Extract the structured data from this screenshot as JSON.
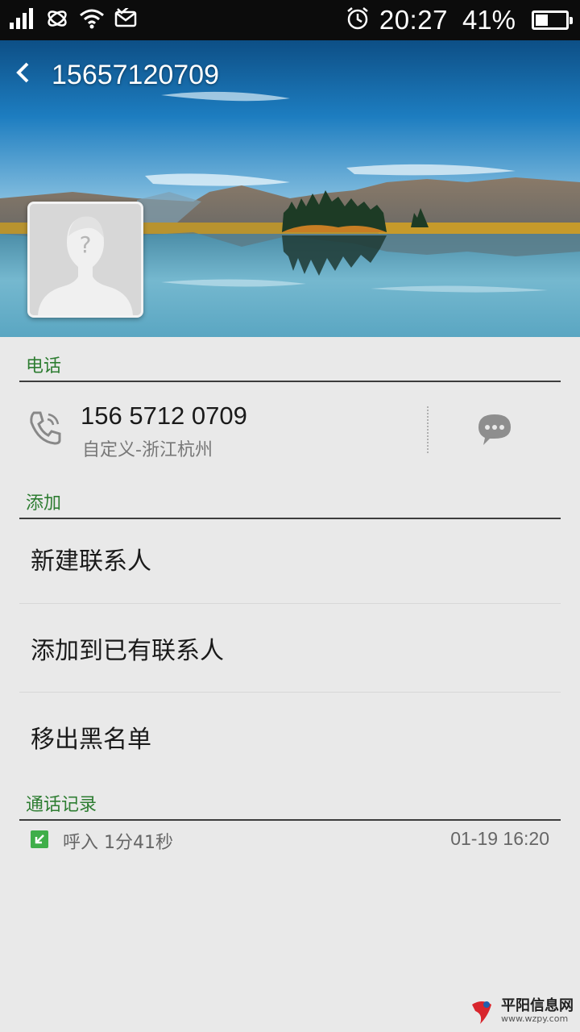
{
  "status_bar": {
    "time": "20:27",
    "battery_percent": "41%",
    "battery_level": 0.41,
    "icons": [
      "signal-icon",
      "carrier-icon",
      "wifi-icon",
      "message-check-icon",
      "alarm-icon",
      "battery-icon"
    ]
  },
  "header": {
    "title": "15657120709",
    "back_icon": "chevron-left-icon",
    "avatar_placeholder": "?"
  },
  "sections": {
    "phone": "电话",
    "add": "添加",
    "call_log": "通话记录"
  },
  "phone_entry": {
    "number": "156 5712 0709",
    "location": "自定义-浙江杭州",
    "call_icon": "phone-icon",
    "message_icon": "message-icon"
  },
  "actions": [
    {
      "label": "新建联系人"
    },
    {
      "label": "添加到已有联系人"
    },
    {
      "label": "移出黑名单"
    }
  ],
  "call_log": [
    {
      "type": "呼入 1分41秒",
      "time": "01-19 16:20",
      "icon": "incoming-call-icon"
    }
  ],
  "watermark": {
    "title": "平阳信息网",
    "url": "www.wzpy.com"
  },
  "colors": {
    "status_bar_bg": "#0c0c0c",
    "page_bg": "#e9e9e9",
    "section_header": "#2e7d32",
    "incoming_icon": "#3fae49"
  }
}
